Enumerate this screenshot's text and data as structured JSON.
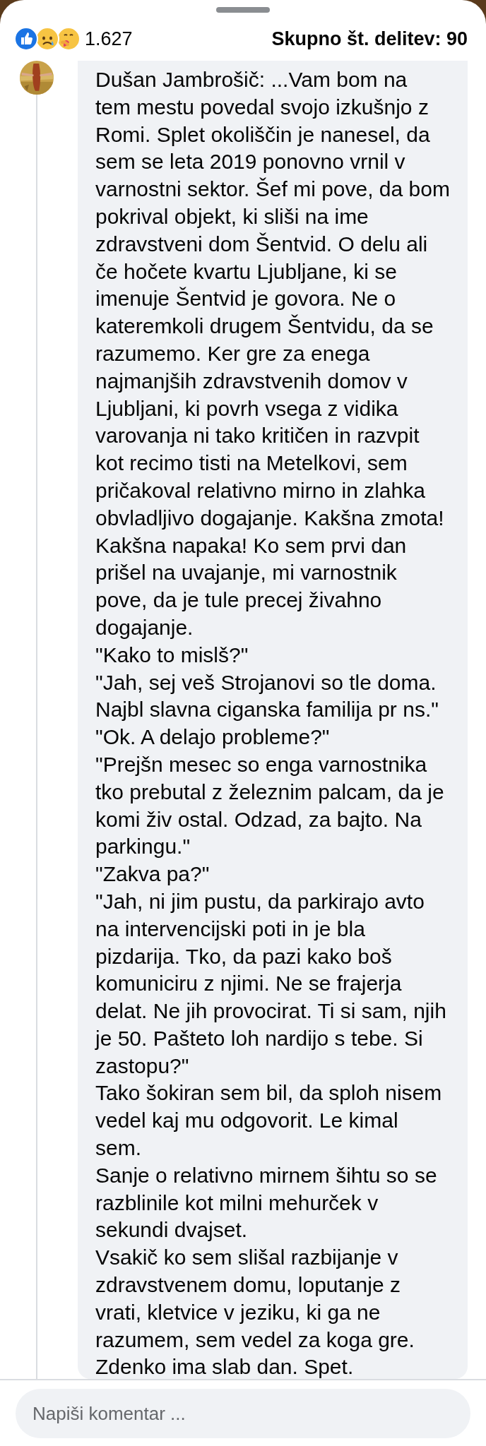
{
  "reactions": {
    "count": "1.627"
  },
  "shares": "Skupno št. delitev: 90",
  "comment": {
    "paragraphs": [
      {
        "lines": [
          "Dušan Jambrošič: ...Vam bom na",
          "tem mestu povedal svojo izkušnjo z",
          "Romi. Splet okoliščin je nanesel, da",
          "sem se leta 2019 ponovno vrnil v",
          "varnostni sektor. Šef mi pove, da bom",
          "pokrival objekt, ki sliši na ime",
          "zdravstveni dom Šentvid. O delu ali",
          "če hočete kvartu Ljubljane, ki se",
          "imenuje Šentvid je govora. Ne o",
          "kateremkoli drugem Šentvidu, da se",
          "razumemo. Ker gre za enega",
          "najmanjših zdravstvenih domov v",
          "Ljubljani, ki povrh vsega z vidika",
          "varovanja ni tako kritičen in razvpit",
          "kot recimo tisti na Metelkovi, sem",
          "pričakoval relativno mirno in zlahka",
          "obvladljivo dogajanje. Kakšna zmota!",
          "Kakšna napaka! Ko sem prvi dan",
          "prišel na uvajanje, mi varnostnik",
          "pove, da je tule precej živahno",
          "dogajanje."
        ]
      },
      {
        "lines": [
          "\"Kako to mislš?\""
        ]
      },
      {
        "lines": [
          "\"Jah, sej veš Strojanovi so tle doma.",
          "Najbl slavna ciganska familija pr ns.\""
        ]
      },
      {
        "lines": [
          "\"Ok. A delajo probleme?\""
        ]
      },
      {
        "lines": [
          "\"Prejšn mesec so enga varnostnika",
          "tko prebutal z železnim palcam, da je",
          "komi živ ostal. Odzad, za bajto. Na",
          "parkingu.\""
        ]
      },
      {
        "lines": [
          "\"Zakva pa?\""
        ]
      },
      {
        "lines": [
          "\"Jah, ni jim pustu, da parkirajo avto",
          "na intervencijski poti in je bla",
          "pizdarija. Tko, da pazi kako boš",
          "komuniciru z njimi. Ne se frajerja",
          "delat. Ne jih provocirat. Ti si sam, njih",
          "je 50. Pašteto loh nardijo s tebe. Si",
          "zastopu?\""
        ]
      },
      {
        "lines": [
          "Tako šokiran sem bil, da sploh nisem",
          "vedel kaj mu odgovorit. Le kimal",
          "sem."
        ]
      },
      {
        "lines": [
          "Sanje o relativno mirnem šihtu so se",
          "razblinile kot milni mehurček v",
          "sekundi dvajset."
        ]
      },
      {
        "lines": [
          "Vsakič ko sem slišal razbijanje v",
          "zdravstvenem domu, loputanje z",
          "vrati, kletvice v jeziku, ki ga ne",
          "razumem, sem vedel za koga gre.",
          "Zdenko ima slab dan. Spet."
        ]
      }
    ]
  },
  "composer": {
    "placeholder": "Napiši komentar ..."
  }
}
